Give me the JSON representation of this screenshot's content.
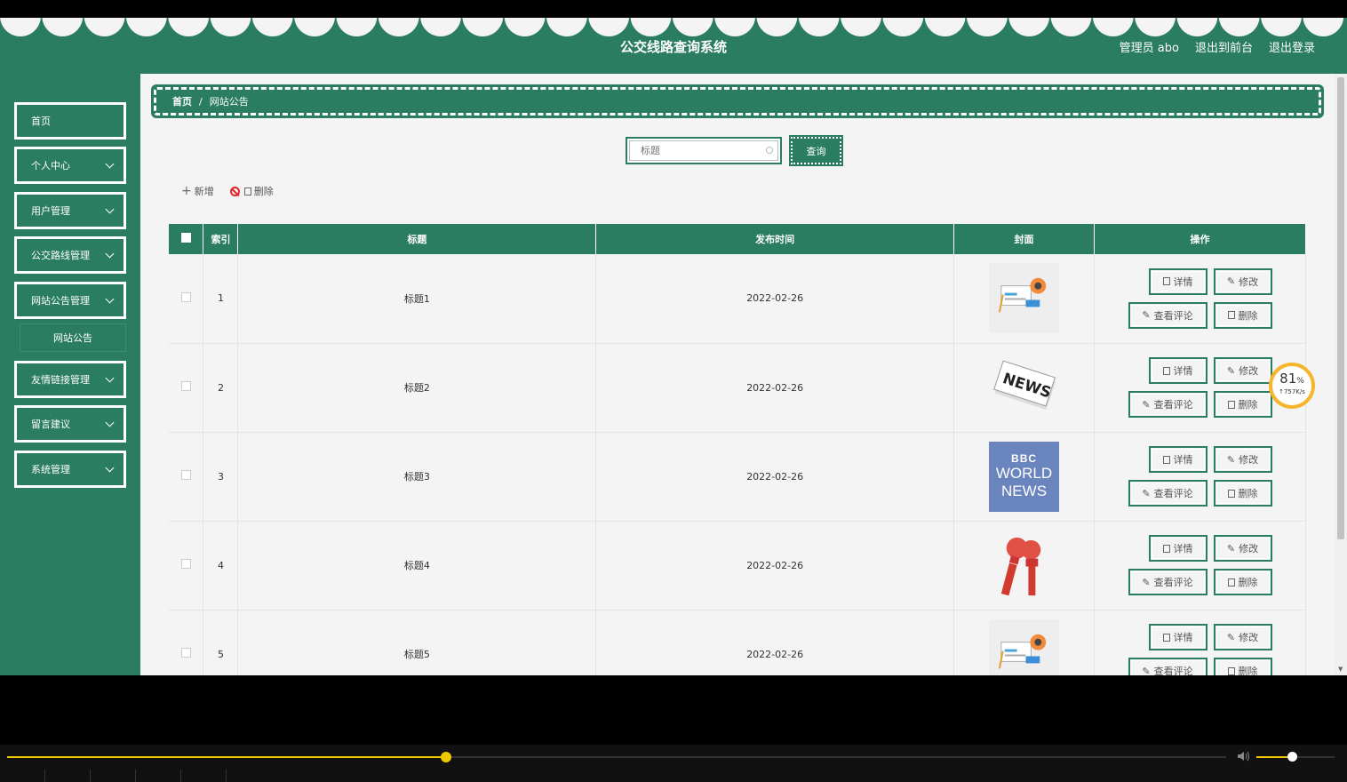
{
  "app": {
    "title": "公交线路查询系统",
    "user_label": "管理员 abo",
    "front_link": "退出到前台",
    "logout_link": "退出登录",
    "accent": "#2a7d60"
  },
  "sidebar": {
    "items": [
      {
        "label": "首页",
        "has_sub": false
      },
      {
        "label": "个人中心",
        "has_sub": true
      },
      {
        "label": "用户管理",
        "has_sub": true
      },
      {
        "label": "公交路线管理",
        "has_sub": true
      },
      {
        "label": "网站公告管理",
        "has_sub": true
      },
      {
        "label": "友情链接管理",
        "has_sub": true
      },
      {
        "label": "留言建议",
        "has_sub": true
      },
      {
        "label": "系统管理",
        "has_sub": true
      }
    ],
    "sub_item": "网站公告"
  },
  "breadcrumb": {
    "home": "首页",
    "sep": "/",
    "current": "网站公告"
  },
  "search": {
    "placeholder": "标题",
    "button": "查询"
  },
  "toolbar": {
    "add": "新增",
    "delete": "删除"
  },
  "table": {
    "columns": [
      "索引",
      "标题",
      "发布时间",
      "封面",
      "操作"
    ],
    "rows": [
      {
        "index": "1",
        "title": "标题1",
        "date": "2022-02-26",
        "cover": "news-paper-icon"
      },
      {
        "index": "2",
        "title": "标题2",
        "date": "2022-02-26",
        "cover": "news-newspaper-icon"
      },
      {
        "index": "3",
        "title": "标题3",
        "date": "2022-02-26",
        "cover": "bbc-world-news"
      },
      {
        "index": "4",
        "title": "标题4",
        "date": "2022-02-26",
        "cover": "live-microphone-icon"
      },
      {
        "index": "5",
        "title": "标题5",
        "date": "2022-02-26",
        "cover": "news-paper-icon"
      }
    ],
    "ops": {
      "detail": "详情",
      "edit": "修改",
      "comments": "查看评论",
      "delete": "删除"
    }
  },
  "bbc_cover": {
    "line1": "BBC",
    "line2": "WORLD",
    "line3": "NEWS"
  },
  "speed_widget": {
    "percent": "81",
    "unit": "%",
    "rate": "↑757K/s"
  },
  "player": {
    "progress": 0.36,
    "volume": 0.45
  }
}
